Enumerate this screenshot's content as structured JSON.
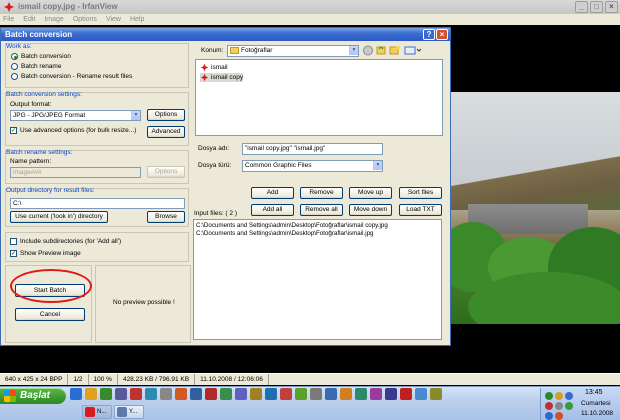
{
  "irfanview": {
    "title": "ismail copy.jpg - IrfanView",
    "menu": [
      "File",
      "Edit",
      "Image",
      "Options",
      "View",
      "Help"
    ],
    "window_buttons": [
      "_",
      "□",
      "×"
    ],
    "status": [
      "640 x 425 x 24 BPP",
      "1/2",
      "100 %",
      "428.23 KB / 796.91 KB",
      "11.10.2008 / 12:06:06"
    ]
  },
  "dialog": {
    "title": "Batch conversion",
    "help_btn": "?",
    "close_btn": "×",
    "work_as": {
      "label": "Work as:",
      "options": [
        "Batch conversion",
        "Batch rename",
        "Batch conversion - Rename result files"
      ],
      "selected": 0
    },
    "conversion_settings": {
      "label": "Batch conversion settings:",
      "output_format_label": "Output format:",
      "output_format": "JPG - JPG/JPEG Format",
      "options_btn": "Options",
      "advanced_checkbox": "Use advanced options (for bulk resize...)",
      "advanced_checked": true,
      "advanced_btn": "Advanced"
    },
    "rename_settings": {
      "label": "Batch rename settings:",
      "name_pattern_label": "Name pattern:",
      "name_pattern": "image###",
      "options_btn": "Options"
    },
    "output_dir": {
      "label": "Output directory for result files:",
      "value": "C:\\",
      "use_current_btn": "Use current ('look in') directory",
      "browse_btn": "Browse"
    },
    "include_subdirs": "Include subdirectories (for 'Add all')",
    "include_subdirs_checked": false,
    "show_preview": "Show Preview image",
    "show_preview_checked": true,
    "start_btn": "Start Batch",
    "cancel_btn": "Cancel",
    "preview_text": "No preview possible !",
    "look_in_label": "Konum:",
    "look_in_value": "Fotoğraflar",
    "files": [
      "ismail",
      "ismail copy"
    ],
    "file_name_label": "Dosya adı:",
    "file_name_value": "\"ismail copy.jpg\" \"ismail.jpg\"",
    "file_type_label": "Dosya türü:",
    "file_type_value": "Common Graphic Files",
    "buttons_row1": [
      "Add",
      "Remove",
      "Move up",
      "Sort files"
    ],
    "buttons_row2": [
      "Add all",
      "Remove all",
      "Move down",
      "Load TXT"
    ],
    "input_files_label": "Input files: ( 2 )",
    "input_files": [
      "C:\\Documents and Settings\\admin\\Desktop\\Fotoğraflar\\ismail copy.jpg",
      "C:\\Documents and Settings\\admin\\Desktop\\Fotoğraflar\\ismail.jpg"
    ]
  },
  "taskbar": {
    "start_label": "Başlat",
    "tasks": [
      "N...",
      "Y..."
    ],
    "time": "13:45",
    "day": "Cumartesi",
    "date": "11.10.2008"
  }
}
